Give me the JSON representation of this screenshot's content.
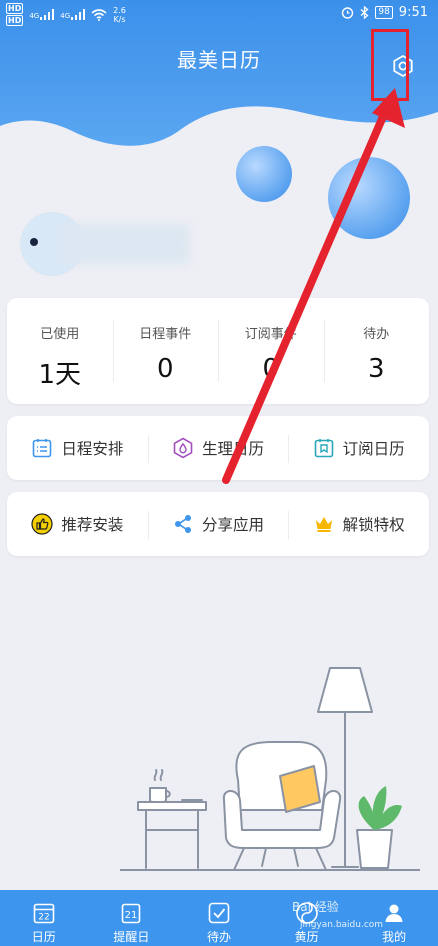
{
  "status": {
    "sim1": "HD",
    "sim2": "HD",
    "net1": "4G",
    "net2": "4G",
    "speed": "2.6",
    "speed_unit": "K/s",
    "battery": "98",
    "time": "9:51"
  },
  "header": {
    "title": "最美日历"
  },
  "profile": {
    "name": "用户"
  },
  "stats": [
    {
      "label": "已使用",
      "value": "1天"
    },
    {
      "label": "日程事件",
      "value": "0"
    },
    {
      "label": "订阅事件",
      "value": "0"
    },
    {
      "label": "待办",
      "value": "3"
    }
  ],
  "features": [
    {
      "label": "日程安排",
      "icon": "schedule-icon"
    },
    {
      "label": "生理日历",
      "icon": "cycle-icon"
    },
    {
      "label": "订阅日历",
      "icon": "subscribe-icon"
    }
  ],
  "extras": [
    {
      "label": "推荐安装",
      "icon": "thumbs-up-icon"
    },
    {
      "label": "分享应用",
      "icon": "share-icon"
    },
    {
      "label": "解锁特权",
      "icon": "crown-icon"
    }
  ],
  "nav": [
    {
      "label": "日历",
      "icon_text": "22"
    },
    {
      "label": "提醒日",
      "icon_text": "21"
    },
    {
      "label": "待办"
    },
    {
      "label": "黄历"
    },
    {
      "label": "我的"
    }
  ],
  "watermark": {
    "brand": "Bai  经验",
    "url": "jingyan.baidu.com"
  },
  "colors": {
    "primary": "#3d95ed",
    "annotation": "#e5232e"
  }
}
